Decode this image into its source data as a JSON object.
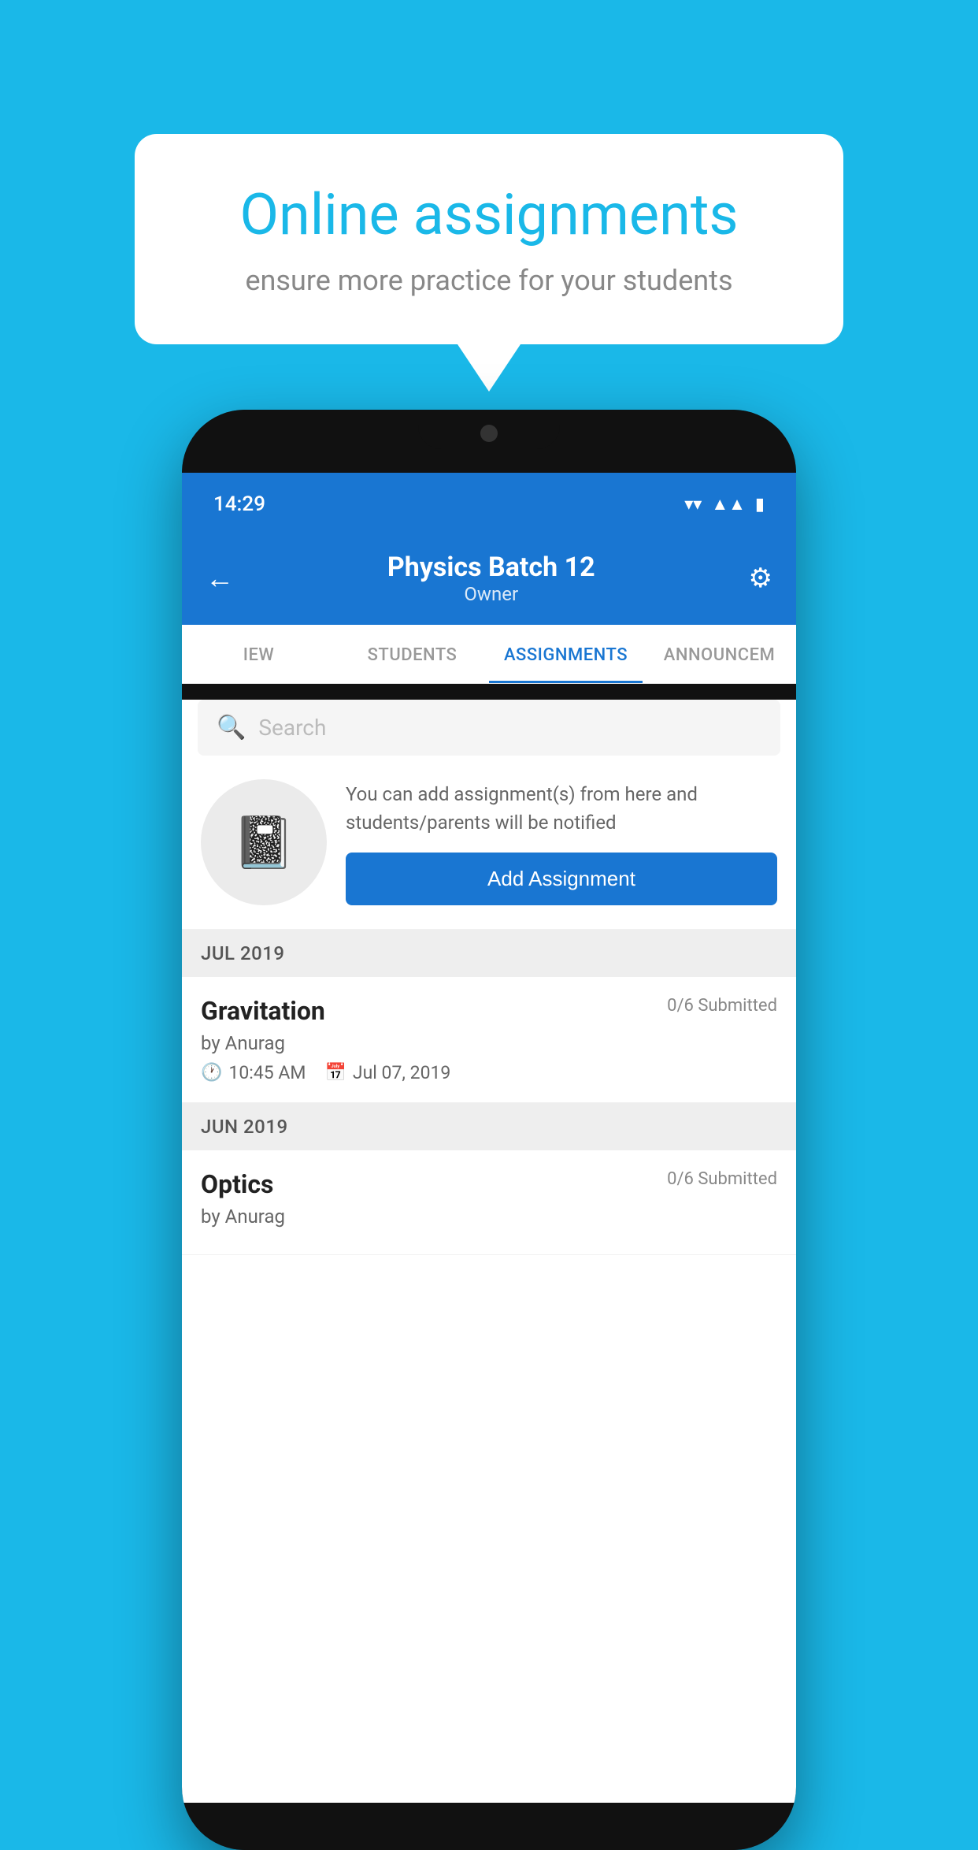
{
  "background_color": "#1ab8e8",
  "speech_bubble": {
    "title": "Online assignments",
    "subtitle": "ensure more practice for your students"
  },
  "phone": {
    "status_bar": {
      "time": "14:29",
      "wifi": "▼",
      "signal": "▲",
      "battery": "▮"
    },
    "header": {
      "back_label": "←",
      "title": "Physics Batch 12",
      "subtitle": "Owner",
      "settings_icon": "⚙"
    },
    "tabs": [
      {
        "label": "IEW",
        "active": false
      },
      {
        "label": "STUDENTS",
        "active": false
      },
      {
        "label": "ASSIGNMENTS",
        "active": true
      },
      {
        "label": "ANNOUNCEM",
        "active": false
      }
    ],
    "search": {
      "placeholder": "Search"
    },
    "promo": {
      "text": "You can add assignment(s) from here and students/parents will be notified",
      "button_label": "Add Assignment"
    },
    "sections": [
      {
        "header": "JUL 2019",
        "assignments": [
          {
            "name": "Gravitation",
            "submitted": "0/6 Submitted",
            "by": "by Anurag",
            "time": "10:45 AM",
            "date": "Jul 07, 2019"
          }
        ]
      },
      {
        "header": "JUN 2019",
        "assignments": [
          {
            "name": "Optics",
            "submitted": "0/6 Submitted",
            "by": "by Anurag",
            "time": "",
            "date": ""
          }
        ]
      }
    ]
  }
}
